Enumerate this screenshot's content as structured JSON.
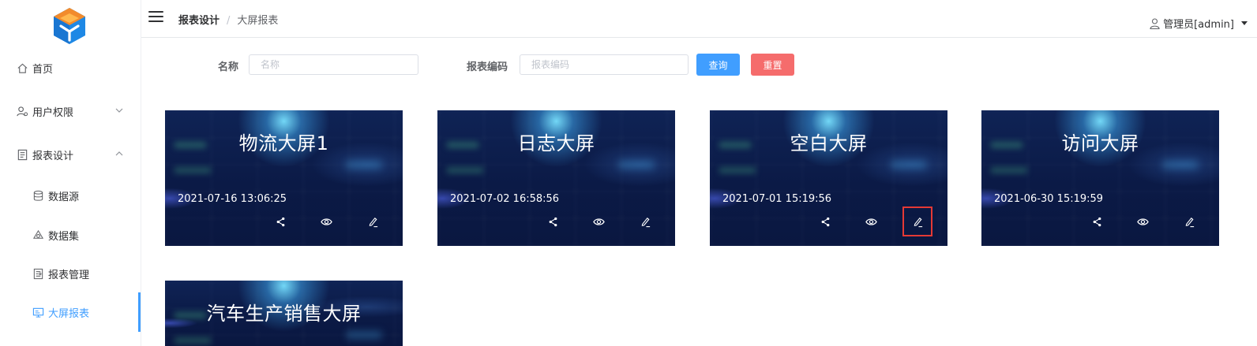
{
  "sidebar": {
    "items": [
      {
        "label": "首页",
        "icon": "home-icon"
      },
      {
        "label": "用户权限",
        "icon": "user-permission-icon"
      },
      {
        "label": "报表设计",
        "icon": "report-design-icon"
      },
      {
        "label": "数据源",
        "icon": "database-icon"
      },
      {
        "label": "数据集",
        "icon": "dataset-icon"
      },
      {
        "label": "报表管理",
        "icon": "report-manage-icon"
      },
      {
        "label": "大屏报表",
        "icon": "monitor-icon"
      }
    ],
    "active_color": "#409eff"
  },
  "header": {
    "breadcrumb": [
      "报表设计",
      "/",
      "大屏报表"
    ],
    "user": "管理员[admin]"
  },
  "search": {
    "name_label": "名称",
    "name_placeholder": "名称",
    "code_label": "报表编码",
    "code_placeholder": "报表编码",
    "query_label": "查询",
    "reset_label": "重置"
  },
  "cards": [
    {
      "title": "物流大屏1",
      "time": "2021-07-16 13:06:25"
    },
    {
      "title": "日志大屏",
      "time": "2021-07-02 16:58:56"
    },
    {
      "title": "空白大屏",
      "time": "2021-07-01 15:19:56"
    },
    {
      "title": "访问大屏",
      "time": "2021-06-30 15:19:59"
    },
    {
      "title": "汽车生产销售大屏",
      "time": ""
    }
  ],
  "colors": {
    "primary": "#409eff",
    "danger": "#f56c6c",
    "card_bg": "#0b1a46",
    "highlight": "#e53935"
  }
}
